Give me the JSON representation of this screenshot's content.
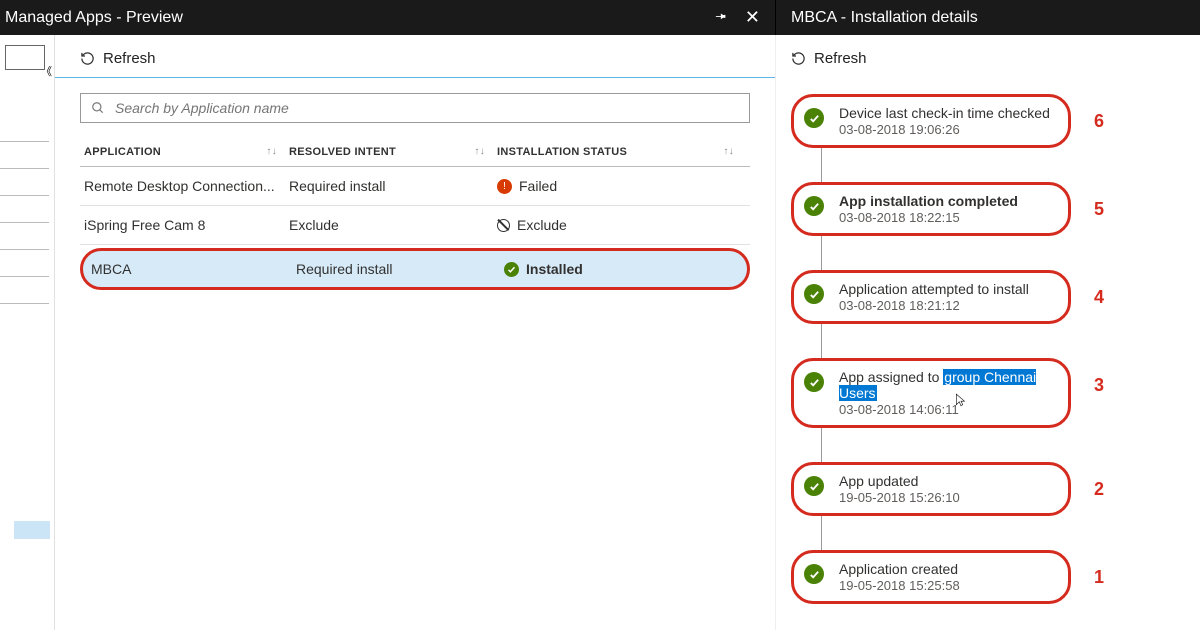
{
  "header": {
    "left_title": "Managed Apps - Preview",
    "right_title": "MBCA - Installation details"
  },
  "refresh_label": "Refresh",
  "search": {
    "placeholder": "Search by Application name"
  },
  "columns": {
    "app": "APPLICATION",
    "intent": "RESOLVED INTENT",
    "status": "INSTALLATION STATUS"
  },
  "status_labels": {
    "failed": "Failed",
    "exclude": "Exclude",
    "installed": "Installed"
  },
  "rows": [
    {
      "app": "Remote Desktop Connection...",
      "intent": "Required install",
      "status": "failed"
    },
    {
      "app": "iSpring Free Cam 8",
      "intent": "Exclude",
      "status": "exclude"
    },
    {
      "app": "MBCA",
      "intent": "Required install",
      "status": "installed",
      "selected": true
    }
  ],
  "timeline": [
    {
      "n": "6",
      "title": "Device last check-in time checked",
      "time": "03-08-2018 19:06:26",
      "bold": false
    },
    {
      "n": "5",
      "title": "App installation completed",
      "time": "03-08-2018 18:22:15",
      "bold": true
    },
    {
      "n": "4",
      "title": "Application attempted to install",
      "time": "03-08-2018 18:21:12",
      "bold": false
    },
    {
      "n": "3",
      "title_pre": "App assigned to ",
      "title_sel": "group Chennai Users",
      "time": "03-08-2018 14:06:11",
      "bold": false,
      "has_highlight": true
    },
    {
      "n": "2",
      "title": "App updated",
      "time": "19-05-2018 15:26:10",
      "bold": false
    },
    {
      "n": "1",
      "title": "Application created",
      "time": "19-05-2018 15:25:58",
      "bold": false
    }
  ]
}
